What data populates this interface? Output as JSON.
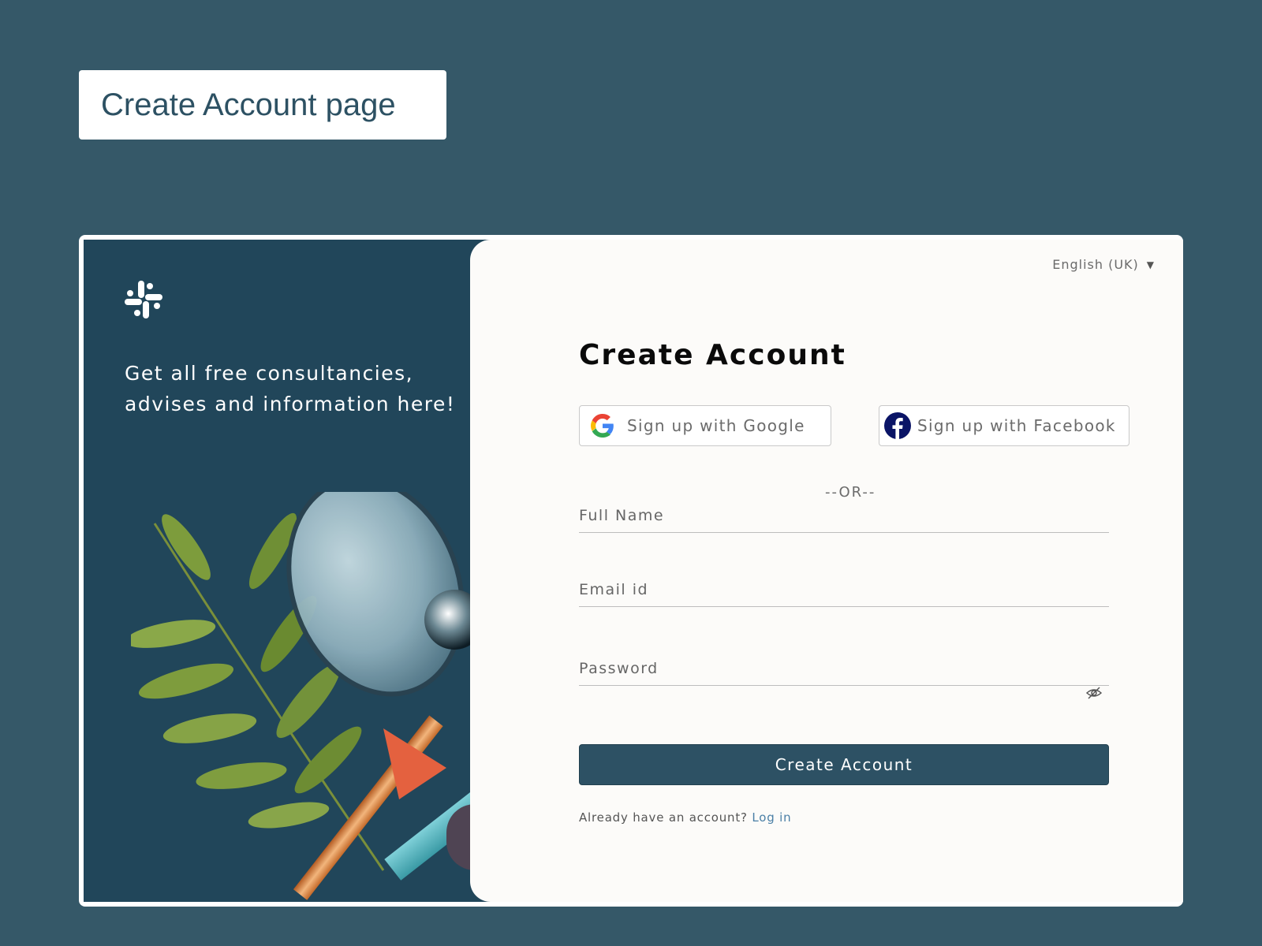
{
  "page_label": "Create Account page",
  "left": {
    "tagline": "Get all free consultancies,\nadvises and  information here!"
  },
  "form": {
    "language": "English (UK)",
    "title": "Create Account",
    "google_label": "Sign up with Google",
    "facebook_label": "Sign up with Facebook",
    "or_text": "--OR--",
    "full_name_placeholder": "Full Name",
    "email_placeholder": "Email id",
    "password_placeholder": "Password",
    "submit_label": "Create Account",
    "already_text": "Already have an account?",
    "login_label": "Log in"
  },
  "icons": {
    "logo": "slack-logo-icon",
    "google": "google-icon",
    "facebook": "facebook-icon",
    "eye": "eye-slash-icon",
    "caret": "caret-down-icon"
  },
  "colors": {
    "background": "#355868",
    "panel_dark": "#21465a",
    "button": "#2d5164",
    "link": "#4a7fa6"
  }
}
